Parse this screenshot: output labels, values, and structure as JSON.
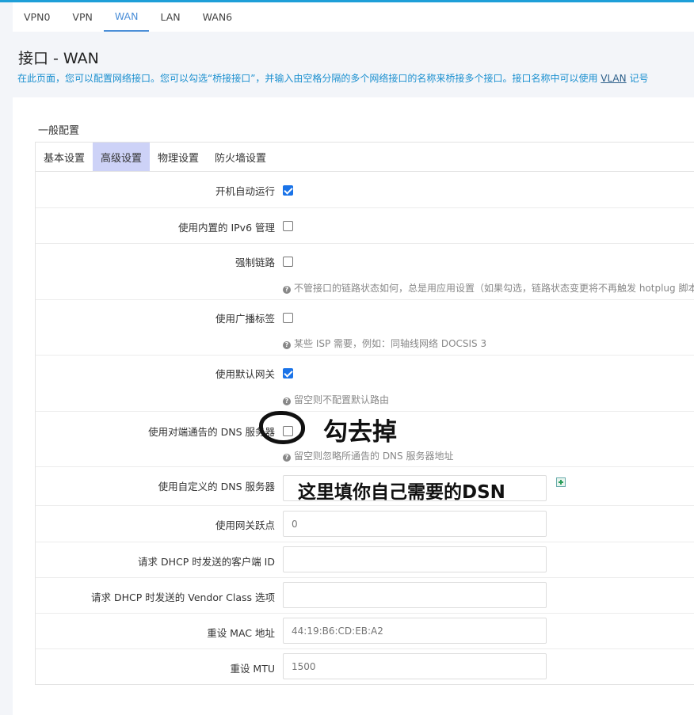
{
  "top_tabs": [
    "VPN0",
    "VPN",
    "WAN",
    "LAN",
    "WAN6"
  ],
  "page": {
    "title": "接口 - WAN",
    "description_before": "在此页面，您可以配置网络接口。您可以勾选“桥接接口”，并输入由空格分隔的多个网络接口的名称来桥接多个接口。接口名称中可以使用 ",
    "description_link": "VLAN",
    "description_after": " 记号"
  },
  "section": {
    "title": "一般配置",
    "tabs": [
      "基本设置",
      "高级设置",
      "物理设置",
      "防火墙设置"
    ],
    "active_tab": "高级设置"
  },
  "fields": {
    "auto_start": {
      "label": "开机自动运行",
      "checked": true
    },
    "ipv6_manage": {
      "label": "使用内置的 IPv6 管理",
      "checked": false
    },
    "force_link": {
      "label": "强制链路",
      "checked": false,
      "help": "不管接口的链路状态如何，总是用应用设置（如果勾选，链路状态变更将不再触发 hotplug 脚本）"
    },
    "broadcast_flag": {
      "label": "使用广播标签",
      "checked": false,
      "help": "某些 ISP 需要，例如：同轴线网络 DOCSIS 3"
    },
    "default_gw": {
      "label": "使用默认网关",
      "checked": true,
      "help": "留空则不配置默认路由"
    },
    "peer_dns": {
      "label": "使用对端通告的 DNS 服务器",
      "checked": false,
      "help": "留空则忽略所通告的 DNS 服务器地址"
    },
    "custom_dns": {
      "label": "使用自定义的 DNS 服务器",
      "value": ""
    },
    "gw_metric": {
      "label": "使用网关跃点",
      "placeholder": "0"
    },
    "client_id": {
      "label": "请求 DHCP 时发送的客户端 ID",
      "value": ""
    },
    "vendor_class": {
      "label": "请求 DHCP 时发送的 Vendor Class 选项",
      "value": ""
    },
    "mac": {
      "label": "重设 MAC 地址",
      "placeholder": "44:19:B6:CD:EB:A2"
    },
    "mtu": {
      "label": "重设 MTU",
      "placeholder": "1500"
    }
  },
  "annotations": {
    "uncheck_note": "勾去掉",
    "dns_note": "这里填你自己需要的DSN"
  }
}
